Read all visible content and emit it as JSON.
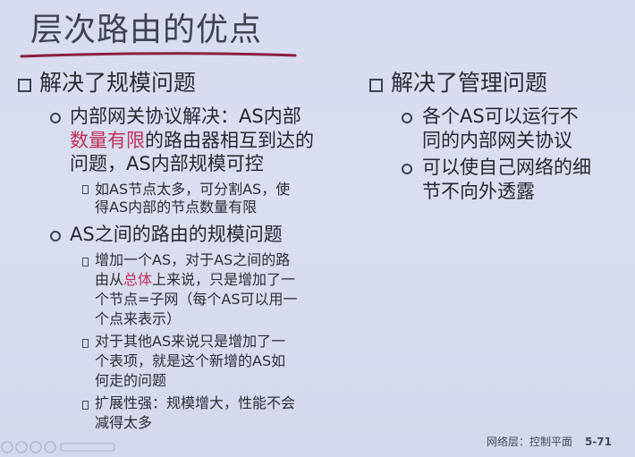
{
  "title": "层次路由的优点",
  "left": {
    "heading": "解决了规模问题",
    "sub1": {
      "lines": [
        [
          "内部网关协议解决：AS内部",
          ""
        ],
        [
          "",
          "数量有限",
          "的路由器相互到达的"
        ],
        [
          "问题，AS内部规模可控"
        ]
      ],
      "line1": "内部网关协议解决：AS内部",
      "line2_red": "数量有限",
      "line2_rest": "的路由器相互到达的",
      "line3": "问题，AS内部规模可控",
      "detail_line1": "如AS节点太多，可分割AS，使",
      "detail_line2": "得AS内部的节点数量有限"
    },
    "sub2": {
      "heading": "AS之间的路由的规模问题",
      "d1_line1": "增加一个AS，对于AS之间的路",
      "d1_line2_pre": "由从",
      "d1_line2_red": "总体",
      "d1_line2_post": "上来说，只是增加了一",
      "d1_line3": "个节点=子网（每个AS可以用一",
      "d1_line4": "个点来表示）",
      "d2_line1": "对于其他AS来说只是增加了一",
      "d2_line2": "个表项，就是这个新增的AS如",
      "d2_line3": "何走的问题",
      "d3_line1": "扩展性强：规模增大，性能不会",
      "d3_line2": "减得太多"
    }
  },
  "right": {
    "heading": "解决了管理问题",
    "b1_line1": "各个AS可以运行不",
    "b1_line2": "同的内部网关协议",
    "b2_line1": "可以使自己网络的细",
    "b2_line2": "节不向外透露"
  },
  "footer": {
    "label": "网络层：控制平面",
    "page": "5-71"
  },
  "colors": {
    "accent_red": "#c0305a",
    "title_rule": "#8a2040"
  }
}
